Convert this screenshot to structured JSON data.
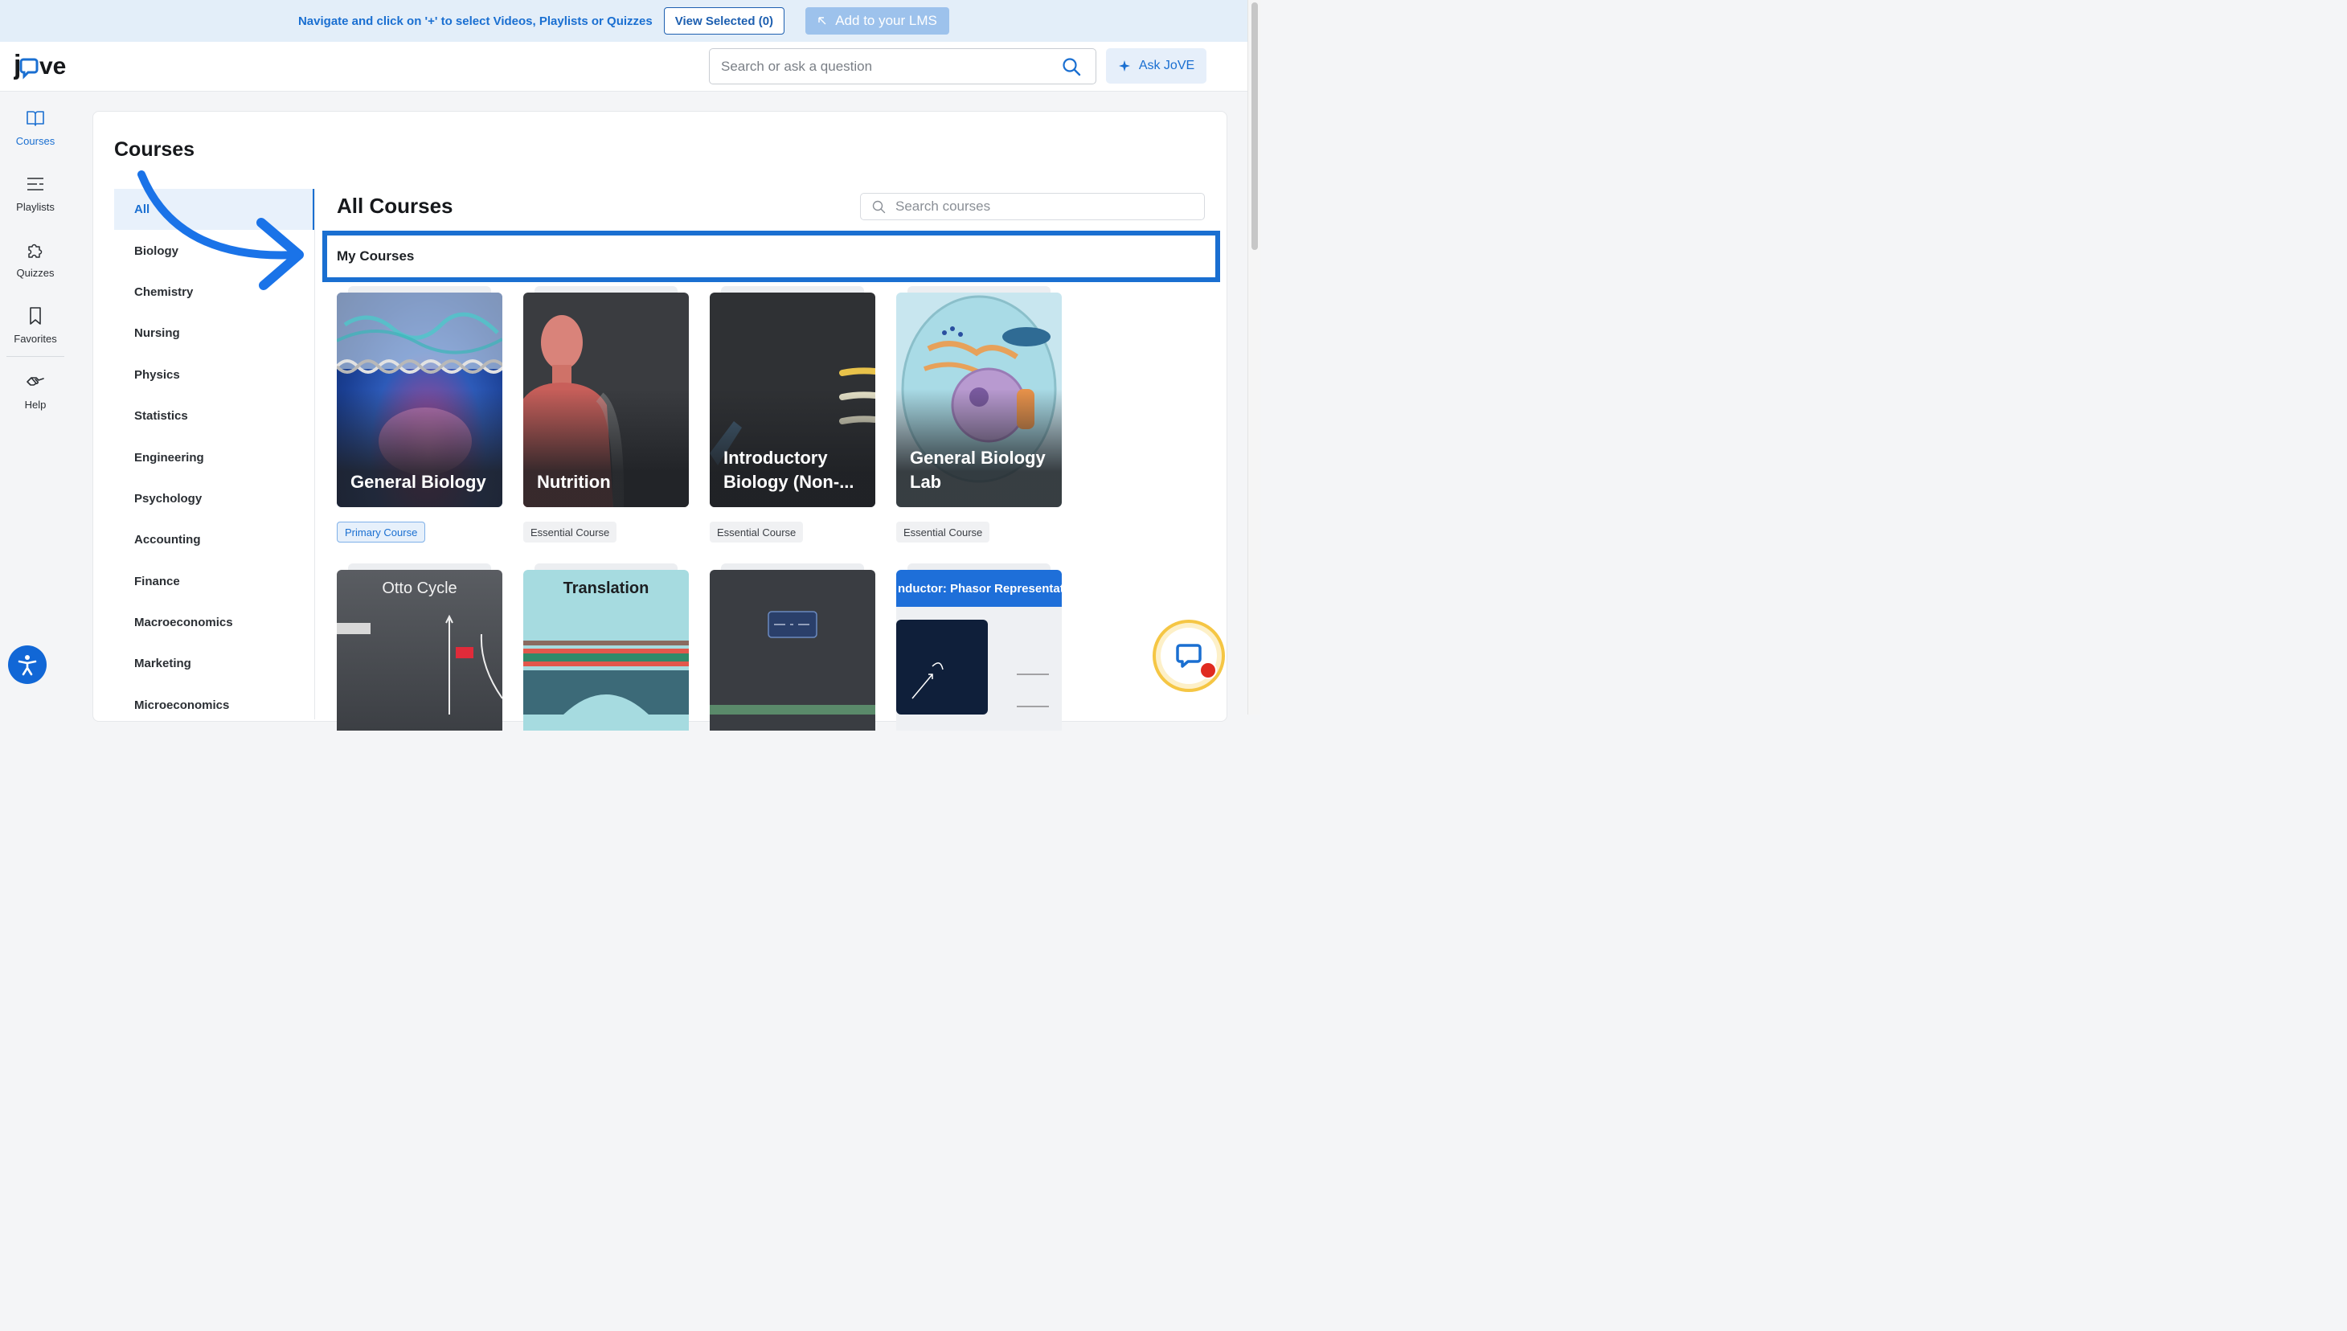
{
  "banner": {
    "text": "Navigate and click on '+' to select Videos, Playlists or Quizzes",
    "view_selected_label": "View Selected (0)",
    "add_lms_label": "Add to your LMS"
  },
  "header": {
    "logo_text": "jove",
    "search_placeholder": "Search or ask a question",
    "ask_label": "Ask JoVE"
  },
  "rail": {
    "items": [
      {
        "label": "Courses",
        "icon": "book-icon",
        "active": true
      },
      {
        "label": "Playlists",
        "icon": "list-icon",
        "active": false
      },
      {
        "label": "Quizzes",
        "icon": "puzzle-icon",
        "active": false
      },
      {
        "label": "Favorites",
        "icon": "bookmark-icon",
        "active": false
      },
      {
        "label": "Help",
        "icon": "handshake-icon",
        "active": false
      }
    ]
  },
  "page": {
    "title": "Courses"
  },
  "categories": [
    "All",
    "Biology",
    "Chemistry",
    "Nursing",
    "Physics",
    "Statistics",
    "Engineering",
    "Psychology",
    "Accounting",
    "Finance",
    "Macroeconomics",
    "Marketing",
    "Microeconomics"
  ],
  "courses": {
    "heading": "All Courses",
    "search_placeholder": "Search courses",
    "section_label": "My Courses",
    "cards": [
      {
        "title": "General Biology",
        "badge": "Primary Course",
        "badge_type": "primary"
      },
      {
        "title": "Nutrition",
        "badge": "Essential Course",
        "badge_type": "essential"
      },
      {
        "title": "Introductory Biology (Non-...",
        "badge": "Essential Course",
        "badge_type": "essential"
      },
      {
        "title": "General Biology Lab",
        "badge": "Essential Course",
        "badge_type": "essential"
      }
    ],
    "second_row": [
      {
        "label": "Otto Cycle"
      },
      {
        "label": "Translation"
      },
      {
        "label": ""
      },
      {
        "label": "nductor: Phasor Representation"
      }
    ]
  },
  "colors": {
    "accent": "#1a6fd1",
    "banner_bg": "#e3eef9",
    "highlight_border": "#1a6fd1",
    "chat_ring": "#f5c644"
  }
}
